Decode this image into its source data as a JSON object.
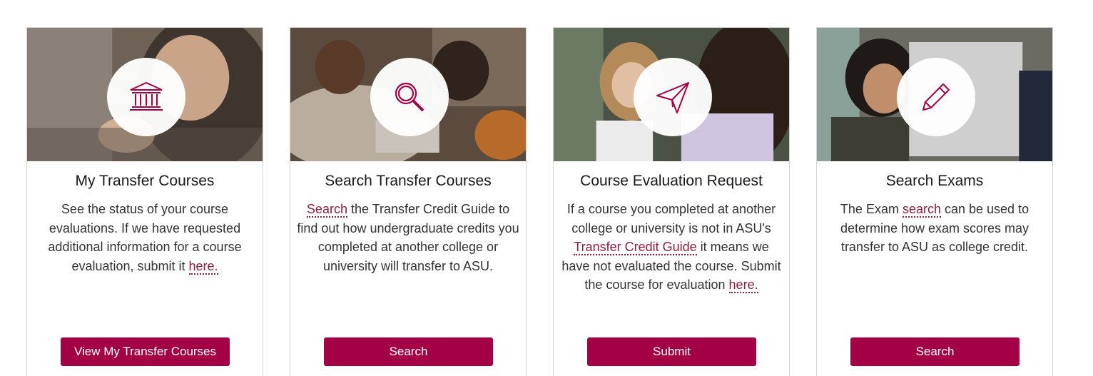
{
  "colors": {
    "accent": "#a30046",
    "link": "#8c1d40",
    "border": "#d4d4d4"
  },
  "cards": [
    {
      "title": "My Transfer Courses",
      "icon": "institution-icon",
      "desc": {
        "before": "See the status of your course evaluations. If we have requested additional information for a course evaluation, submit it ",
        "link": "here.",
        "after": ""
      },
      "button": "View My Transfer Courses"
    },
    {
      "title": "Search Transfer Courses",
      "icon": "search-icon",
      "desc": {
        "before": "",
        "link": "Search",
        "after": " the Transfer Credit Guide to find out how undergraduate credits you completed at another college or university will transfer to ASU."
      },
      "button": "Search"
    },
    {
      "title": "Course Evaluation Request",
      "icon": "paper-plane-icon",
      "desc": {
        "before": "If a course you completed at another college or university is not in ASU's ",
        "link": "Transfer Credit Guide",
        "middle": " it means we have not evaluated the course. Submit the course for evaluation ",
        "link2": "here."
      },
      "button": "Submit"
    },
    {
      "title": "Search Exams",
      "icon": "pencil-icon",
      "desc": {
        "before": "The Exam ",
        "link": "search",
        "after": " can be used to determine how exam scores may transfer to ASU as college credit."
      },
      "button": "Search"
    }
  ]
}
